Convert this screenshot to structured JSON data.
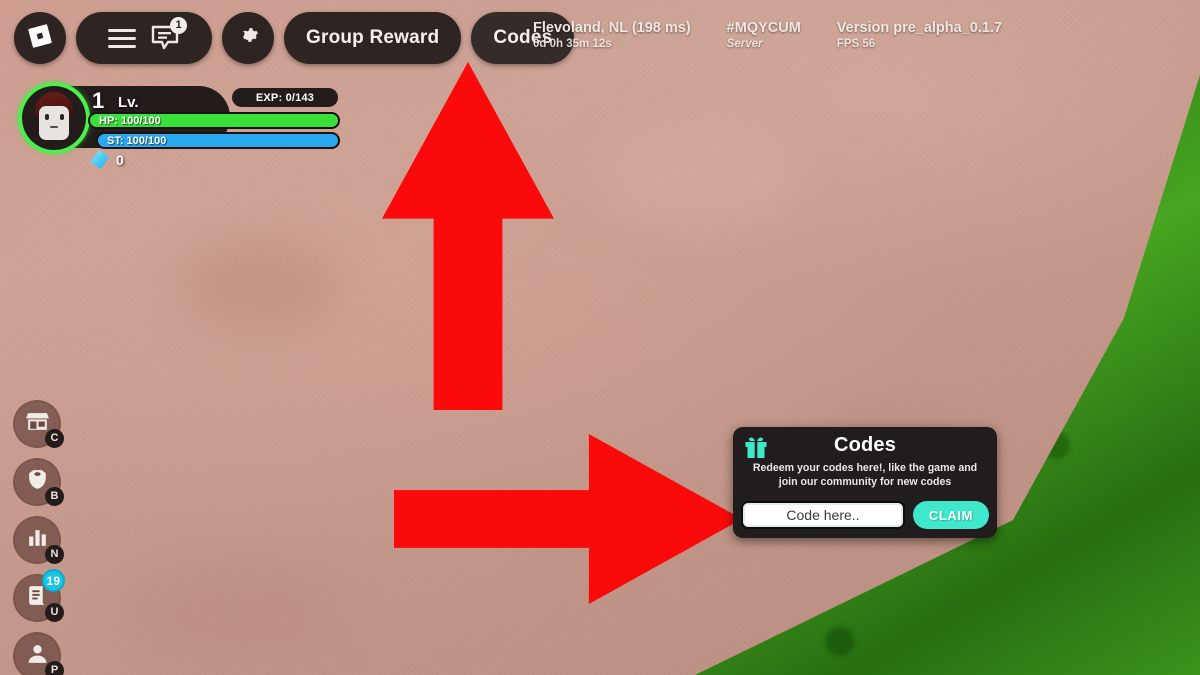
{
  "topnav": {
    "logo_icon": "roblox-logo-icon",
    "menu_icon": "hamburger-menu-icon",
    "chat_icon": "chat-bubble-icon",
    "chat_badge": "1",
    "settings_icon": "gear-icon",
    "group_reward_label": "Group Reward",
    "codes_label": "Codes"
  },
  "server_info": {
    "region": "Flevoland, NL (198 ms)",
    "uptime": "0d 0h 35m 12s",
    "server_code": "#MQYCUM",
    "server_label": "Server",
    "version": "Version pre_alpha_0.1.7",
    "fps": "FPS 56"
  },
  "hud": {
    "level_number": "1",
    "level_label": "Lv.",
    "exp": "EXP: 0/143",
    "hp": "HP: 100/100",
    "stamina": "ST: 100/100",
    "gem_icon": "gem-icon",
    "gem_count": "0",
    "avatar_icon": "player-avatar"
  },
  "sidebar": {
    "items": [
      {
        "name": "shop",
        "icon": "shop-icon",
        "key": "C",
        "notif": ""
      },
      {
        "name": "armor",
        "icon": "armor-icon",
        "key": "B",
        "notif": ""
      },
      {
        "name": "stats",
        "icon": "stats-bars-icon",
        "key": "N",
        "notif": ""
      },
      {
        "name": "quests",
        "icon": "quest-scroll-icon",
        "key": "U",
        "notif": "19"
      },
      {
        "name": "profile",
        "icon": "player-profile-icon",
        "key": "P",
        "notif": ""
      }
    ]
  },
  "annotations": {
    "arrow_up": "red-up-arrow-pointing-to-codes-button",
    "arrow_right": "red-right-arrow-pointing-to-code-input"
  },
  "codes_dialog": {
    "gift_icon": "gift-box-icon",
    "title": "Codes",
    "description": "Redeem your codes here!, like the game and join our community for new codes",
    "input_placeholder": "Code here..",
    "input_value": "",
    "claim_label": "CLAIM"
  },
  "colors": {
    "accent_teal": "#3fe8cb",
    "arrow_red": "#fa0a0a",
    "hp_green": "#3ae03a",
    "stamina_blue": "#29a8ef",
    "nav_dark": "#2e2523",
    "notif_cyan": "#18c5e8"
  }
}
